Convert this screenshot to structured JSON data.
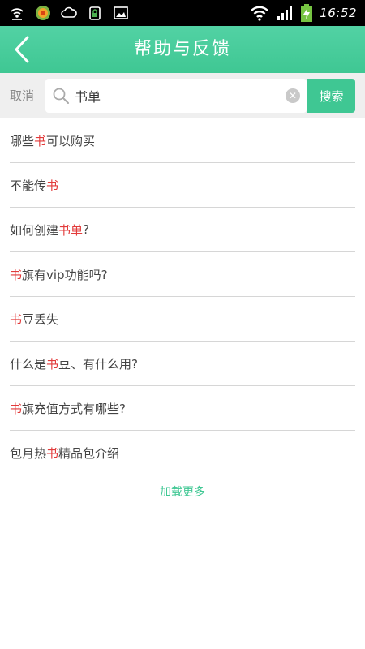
{
  "status_bar": {
    "time": "16:52",
    "left_icons": [
      "wifi-hotspot-icon",
      "game-app-icon",
      "cloud-icon",
      "sim-lock-icon",
      "image-icon"
    ],
    "right_icons": [
      "wifi-signal-icon",
      "cell-signal-icon",
      "battery-charging-icon"
    ]
  },
  "header": {
    "title": "帮助与反馈",
    "back_icon": "chevron-left-icon",
    "bg_color": "#3fc793"
  },
  "search": {
    "cancel_label": "取消",
    "query": "书单",
    "button_label": "搜索",
    "search_icon": "search-icon",
    "clear_icon": "clear-icon"
  },
  "results": [
    {
      "before": "哪些",
      "highlight": "书",
      "after": "可以购买"
    },
    {
      "before": "不能传",
      "highlight": "书",
      "after": ""
    },
    {
      "before": "如何创建",
      "highlight": "书单",
      "after": "?"
    },
    {
      "before": "",
      "highlight": "书",
      "after": "旗有vip功能吗?"
    },
    {
      "before": "",
      "highlight": "书",
      "after": "豆丢失"
    },
    {
      "before": "什么是",
      "highlight": "书",
      "after": "豆、有什么用?"
    },
    {
      "before": "",
      "highlight": "书",
      "after": "旗充值方式有哪些?"
    },
    {
      "before": "包月热",
      "highlight": "书",
      "after": "精品包介绍"
    }
  ],
  "load_more_label": "加载更多",
  "colors": {
    "accent": "#3fc793",
    "highlight": "#e23b3b"
  }
}
